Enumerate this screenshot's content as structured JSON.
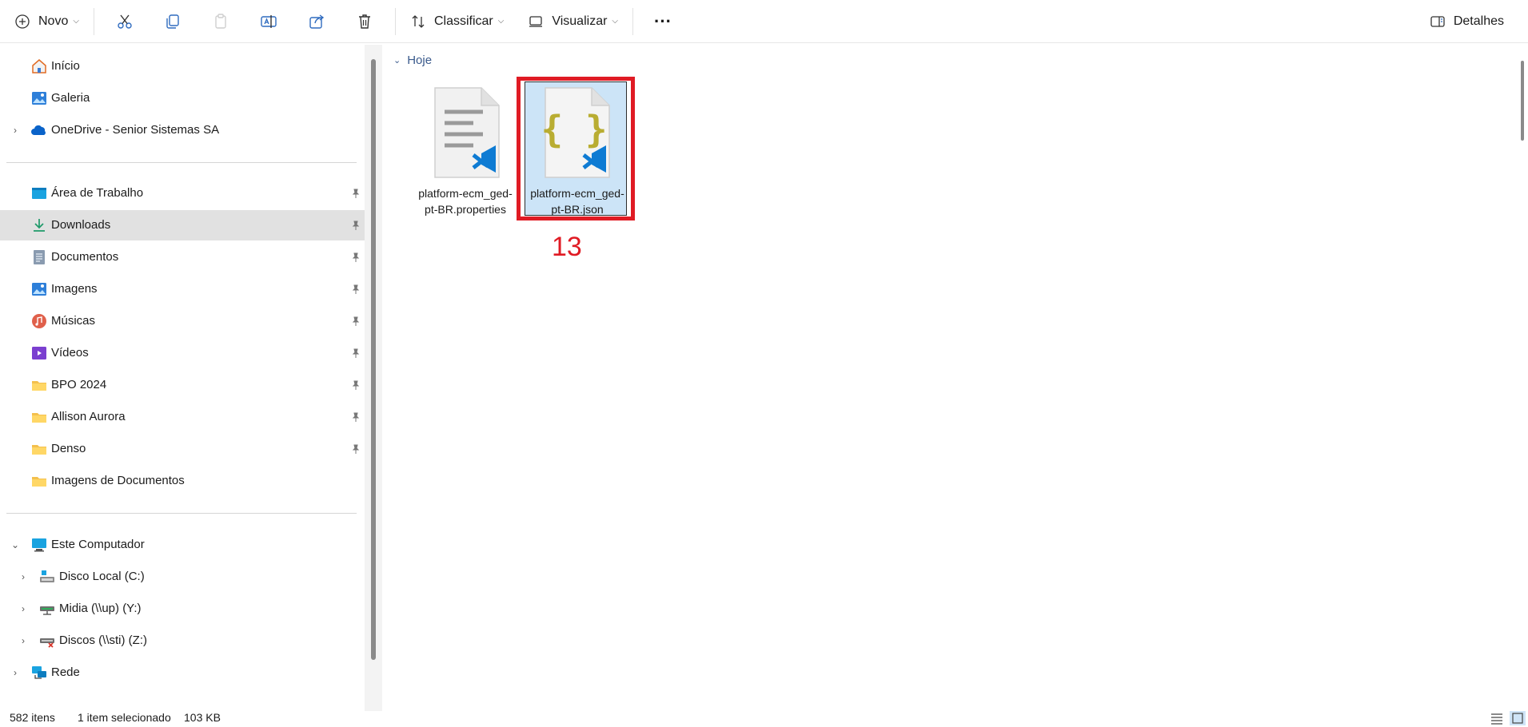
{
  "toolbar": {
    "new_label": "Novo",
    "sort_label": "Classificar",
    "view_label": "Visualizar",
    "more_label": "···",
    "details_label": "Detalhes"
  },
  "sidebar": {
    "quick": [
      {
        "label": "Início",
        "icon": "home-icon"
      },
      {
        "label": "Galeria",
        "icon": "gallery-icon"
      },
      {
        "label": "OneDrive - Senior Sistemas SA",
        "icon": "onedrive-icon"
      }
    ],
    "pinned": [
      {
        "label": "Área de Trabalho",
        "icon": "desktop-folder-icon"
      },
      {
        "label": "Downloads",
        "icon": "downloads-icon"
      },
      {
        "label": "Documentos",
        "icon": "documents-icon"
      },
      {
        "label": "Imagens",
        "icon": "pictures-icon"
      },
      {
        "label": "Músicas",
        "icon": "music-icon"
      },
      {
        "label": "Vídeos",
        "icon": "videos-icon"
      },
      {
        "label": "BPO 2024",
        "icon": "folder-icon"
      },
      {
        "label": "Allison Aurora",
        "icon": "folder-icon"
      },
      {
        "label": "Denso",
        "icon": "folder-icon"
      },
      {
        "label": "Imagens de Documentos",
        "icon": "folder-icon"
      }
    ],
    "computer": [
      {
        "label": "Este Computador",
        "icon": "computer-icon"
      },
      {
        "label": "Disco Local (C:)",
        "icon": "drive-icon"
      },
      {
        "label": "Midia (\\\\up) (Y:)",
        "icon": "network-drive-icon"
      },
      {
        "label": "Discos (\\\\sti) (Z:)",
        "icon": "disconnected-drive-icon"
      },
      {
        "label": "Rede",
        "icon": "network-icon"
      }
    ]
  },
  "content": {
    "group_label": "Hoje",
    "files": [
      {
        "name": "platform-ecm_ged-pt-BR.properties",
        "type": "properties"
      },
      {
        "name": "platform-ecm_ged-pt-BR.json",
        "type": "json"
      }
    ],
    "annotation_number": "13"
  },
  "status": {
    "item_count": "582 itens",
    "selection": "1 item selecionado",
    "size": "103 KB"
  },
  "colors": {
    "selection_bg": "#cce4f7",
    "highlight": "#e01b24",
    "nav_selected": "#e1e1e1"
  }
}
